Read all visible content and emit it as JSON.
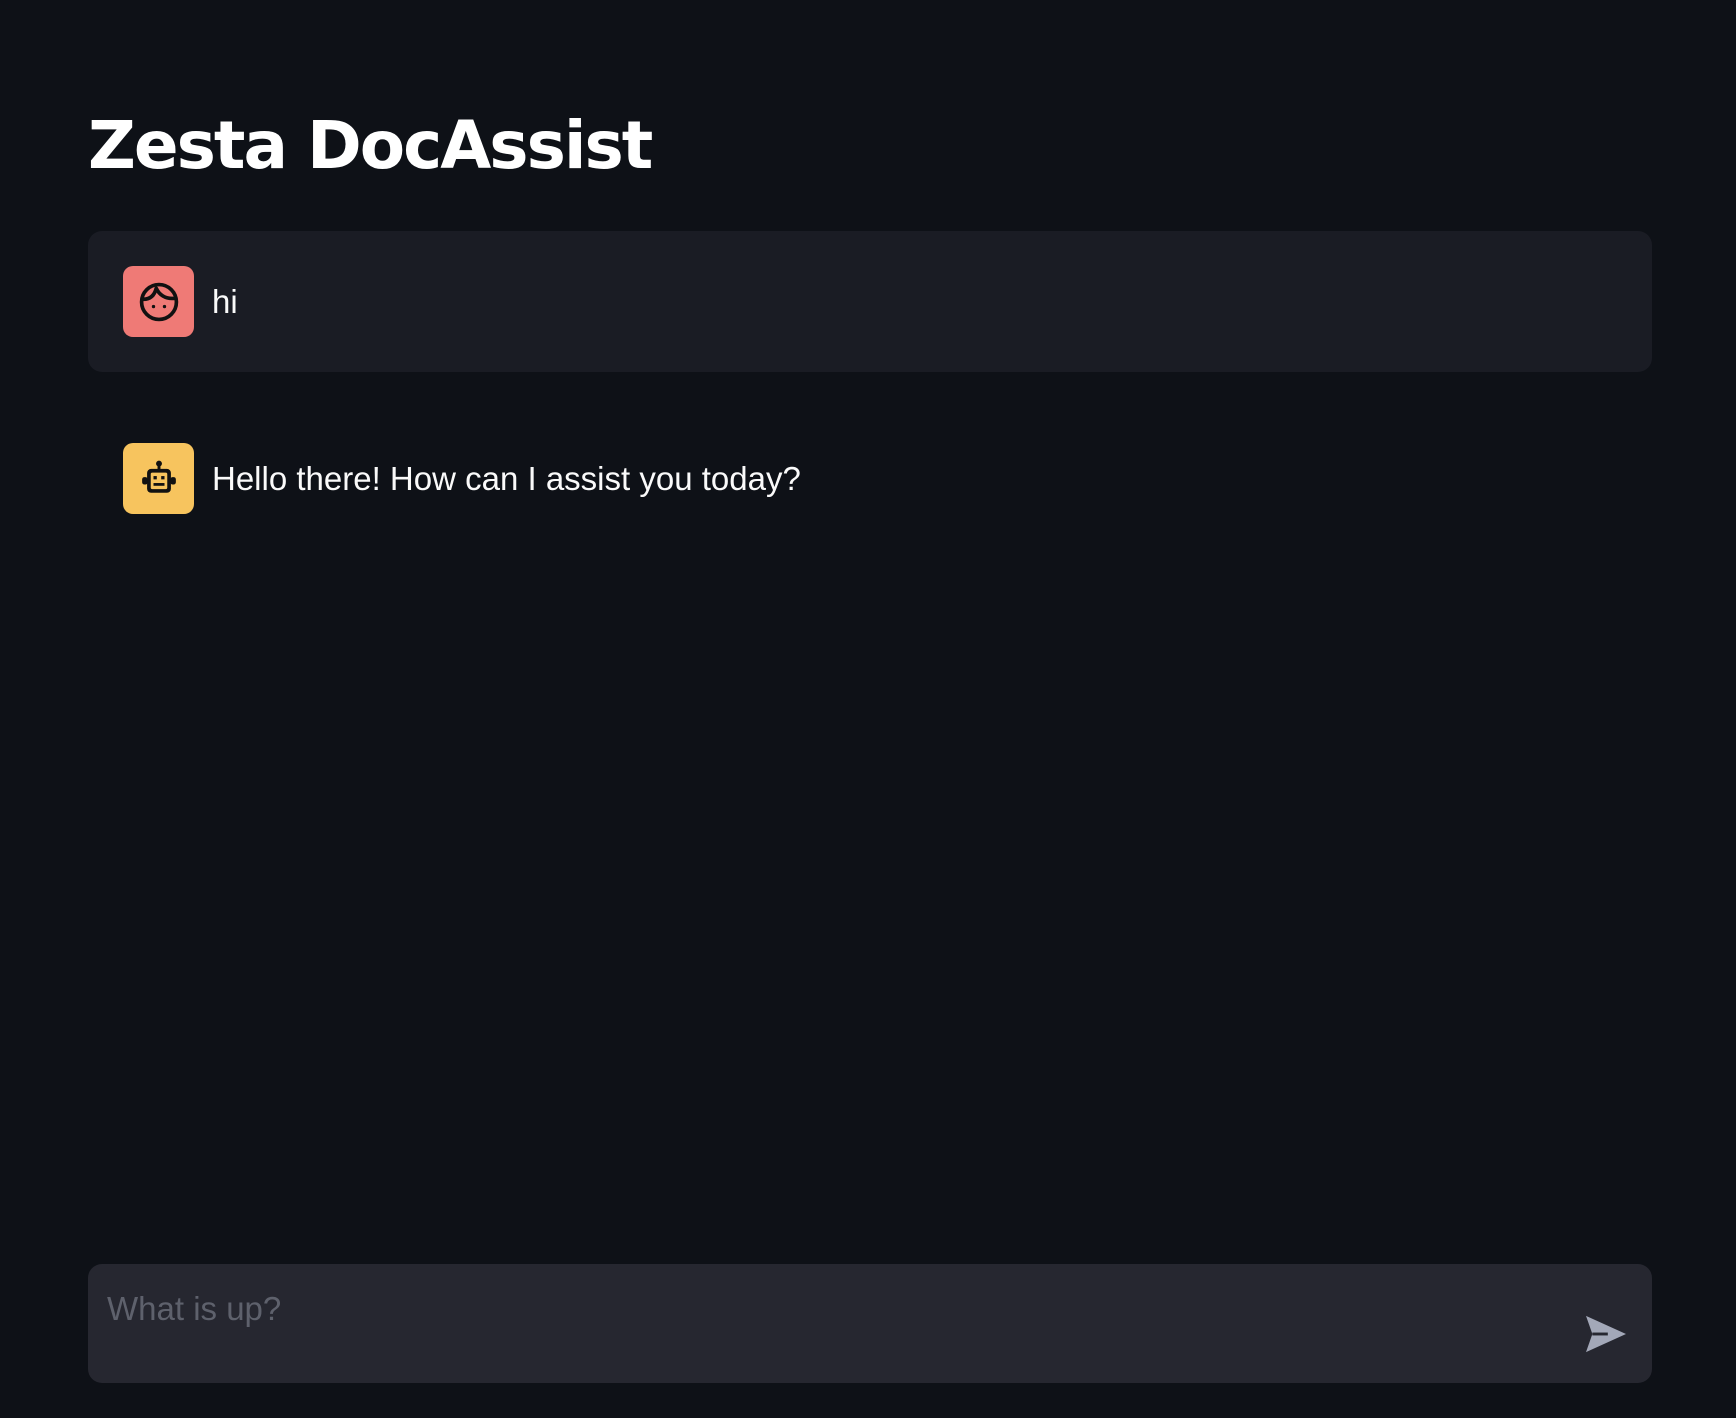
{
  "app": {
    "title": "Zesta DocAssist"
  },
  "messages": [
    {
      "role": "user",
      "avatar_icon": "user-face-icon",
      "avatar_color": "#ef7a76",
      "text": "hi"
    },
    {
      "role": "assistant",
      "avatar_icon": "robot-icon",
      "avatar_color": "#f7c45e",
      "text": "Hello there! How can I assist you today?"
    }
  ],
  "chat_input": {
    "placeholder": "What is up?",
    "value": "",
    "send_icon": "send-icon"
  },
  "colors": {
    "background": "#0e1117",
    "user_message_background": "#1a1c24",
    "input_background": "#262730",
    "text": "#fafafa",
    "placeholder": "#5e616c",
    "send_icon": "#a3a8b8"
  }
}
